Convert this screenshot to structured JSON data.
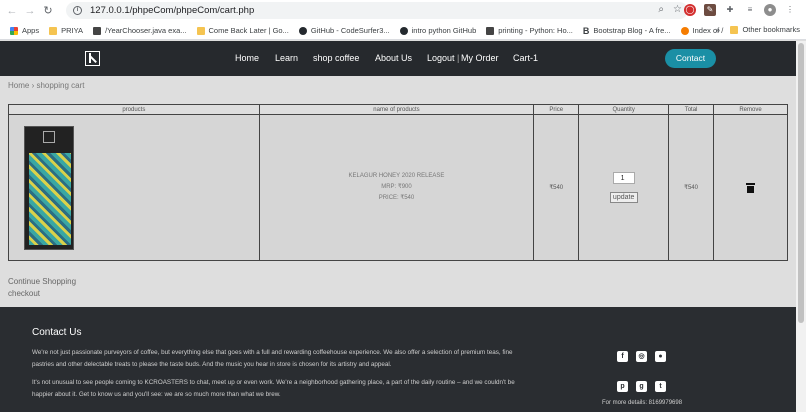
{
  "browser": {
    "url": "127.0.0.1/phpeCom/phpeCom/cart.php",
    "bookmarks": [
      {
        "label": "Apps",
        "icon": "grid"
      },
      {
        "label": "PRIYA",
        "icon": "folder"
      },
      {
        "label": "/YearChooser.java exa...",
        "icon": "dark"
      },
      {
        "label": "Come Back Later | Go...",
        "icon": "folder"
      },
      {
        "label": "GitHub - CodeSurfer3...",
        "icon": "gh"
      },
      {
        "label": "intro python GitHub",
        "icon": "gh"
      },
      {
        "label": "printing - Python: Ho...",
        "icon": "dark"
      },
      {
        "label": "Bootstrap Blog - A fre...",
        "icon": "bold"
      },
      {
        "label": "Index of /",
        "icon": "blog"
      }
    ],
    "more_symbol": "»",
    "other_bookmarks": "Other bookmarks"
  },
  "header": {
    "nav": [
      "Home",
      "Learn",
      "shop coffee",
      "About Us",
      "Logout",
      "My Order",
      "Cart-1"
    ],
    "separator": "|",
    "contact": "Contact"
  },
  "breadcrumb": "Home › shopping cart",
  "cart": {
    "columns": [
      "products",
      "name of products",
      "Price",
      "Quantity",
      "Total",
      "Remove"
    ],
    "item": {
      "name": "KELAGUR HONEY 2020 RELEASE",
      "mrp": "MRP: ₹900",
      "price_line": "PRICE: ₹540",
      "price": "₹540",
      "quantity": "1",
      "update": "update",
      "total": "₹540"
    }
  },
  "links": {
    "continue": "Continue Shopping",
    "checkout": "checkout"
  },
  "footer": {
    "title": "Contact Us",
    "para1": "We're not just passionate purveyors of coffee, but everything else that goes with a full and rewarding coffeehouse experience. We also offer a selection of premium teas, fine pastries and other delectable treats to please the taste buds. And the music you hear in store is chosen for its artistry and appeal.",
    "para2": "It's not unusual to see people coming to KCROASTERS to chat, meet up or even work. We're a neighborhood gathering place, a part of the daily routine – and we couldn't be happier about it. Get to know us and you'll see: we are so much more than what we brew.",
    "more_details": "For more details: 8169979698"
  },
  "colors": {
    "header_bg": "#26292d",
    "contact_btn": "#1a8fa5",
    "footer_bg": "#2a2d31",
    "page_bg": "#dedede"
  }
}
